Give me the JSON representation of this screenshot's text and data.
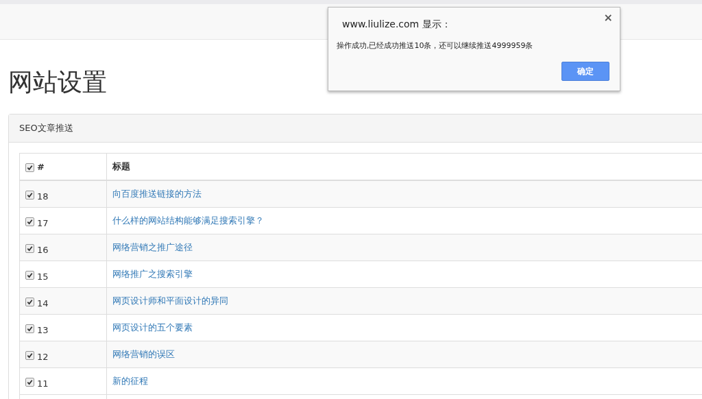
{
  "page_title": "网站设置",
  "panel": {
    "title": "SEO文章推送",
    "table": {
      "columns": [
        {
          "label": "#",
          "checked": true
        },
        {
          "label": "标题"
        }
      ],
      "rows": [
        {
          "id": "18",
          "title": "向百度推送链接的方法",
          "checked": true
        },
        {
          "id": "17",
          "title": "什么样的网站结构能够满足搜索引擎？",
          "checked": true
        },
        {
          "id": "16",
          "title": "网络营销之推广途径",
          "checked": true
        },
        {
          "id": "15",
          "title": "网络推广之搜索引擎",
          "checked": true
        },
        {
          "id": "14",
          "title": "网页设计师和平面设计的异同",
          "checked": true
        },
        {
          "id": "13",
          "title": "网页设计的五个要素",
          "checked": true
        },
        {
          "id": "12",
          "title": "网络营销的误区",
          "checked": true
        },
        {
          "id": "11",
          "title": "新的征程",
          "checked": true
        }
      ]
    }
  },
  "dialog": {
    "title": "www.liulize.com 显示：",
    "close": "×",
    "message": "操作成功,已经成功推送10条，还可以继续推送4999959条",
    "button": "确定"
  }
}
